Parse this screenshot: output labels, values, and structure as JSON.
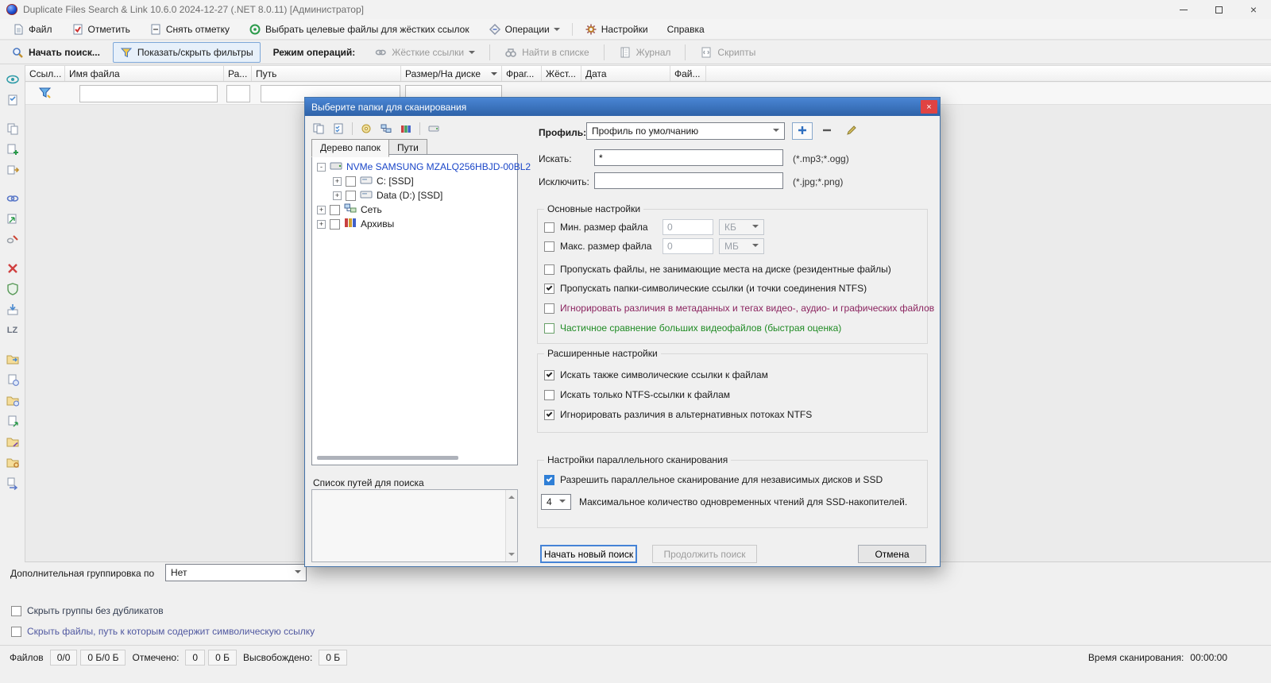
{
  "colors": {
    "accent_blue": "#2f7fd6",
    "dialog_titlebar_from": "#4a86d4",
    "dialog_titlebar_to": "#2e62a8",
    "close_button_red": "#e04343",
    "metadata_text": "#8b2560",
    "partial_compare_text": "#1f8b24",
    "tree_selected_text": "#1a46c8",
    "hide_groups_text": "#323c50",
    "hide_symlink_text": "#5058a0"
  },
  "titlebar": {
    "title": "Duplicate Files Search & Link 10.6.0 2024-12-27 (.NET 8.0.11) [Администратор]"
  },
  "menubar": {
    "file": "Файл",
    "mark": "Отметить",
    "unmark": "Снять отметку",
    "select_targets": "Выбрать целевые файлы для жёстких ссылок",
    "operations": "Операции",
    "settings": "Настройки",
    "help": "Справка"
  },
  "toolbar": {
    "start_search": "Начать поиск...",
    "toggle_filters": "Показать/скрыть фильтры",
    "operations_mode": "Режим операций:",
    "hard_links": "Жёсткие ссылки",
    "find_in_list": "Найти в списке",
    "journal": "Журнал",
    "scripts": "Скрипты"
  },
  "grid": {
    "columns": [
      "Ссыл...",
      "Имя файла",
      "Ра...",
      "Путь",
      "Размер/На диске",
      "Фраг...",
      "Жёст...",
      "Дата",
      "Фай..."
    ],
    "filter_values": {
      "name": "",
      "ra": "",
      "path": "",
      "size": ""
    }
  },
  "sidebar": {
    "lz_label": "LZ"
  },
  "dialog": {
    "title": "Выберите папки для сканирования",
    "tabs": {
      "tree": "Дерево папок",
      "paths": "Пути"
    },
    "tree": [
      {
        "label": "NVMe SAMSUNG MZALQ256HBJD-00BL2",
        "selected": true
      },
      {
        "label": "C: [SSD]",
        "checked": false
      },
      {
        "label": "Data (D:) [SSD]",
        "checked": false
      },
      {
        "label": "Сеть",
        "checked": false
      },
      {
        "label": "Архивы",
        "checked": false
      }
    ],
    "paths_list_label": "Список путей для поиска",
    "profile": {
      "label": "Профиль:",
      "value": "Профиль по умолчанию"
    },
    "search": {
      "label": "Искать:",
      "value": "*",
      "hint": "(*.mp3;*.ogg)"
    },
    "exclude": {
      "label": "Исключить:",
      "value": "",
      "hint": "(*.jpg;*.png)"
    },
    "basic": {
      "title": "Основные настройки",
      "min_size": {
        "label": "Мин. размер файла",
        "value": "0",
        "unit": "КБ",
        "checked": false
      },
      "max_size": {
        "label": "Макс. размер файла",
        "value": "0",
        "unit": "МБ",
        "checked": false
      },
      "skip_resident": {
        "label": "Пропускать файлы, не занимающие места на диске (резидентные файлы)",
        "checked": false
      },
      "skip_symlink_dirs": {
        "label": "Пропускать папки-символические ссылки (и точки соединения NTFS)",
        "checked": true
      },
      "ignore_metadata": {
        "label": "Игнорировать различия в метаданных и тегах видео-, аудио- и графических файлов",
        "checked": false
      },
      "partial_compare": {
        "label": "Частичное сравнение больших видеофайлов (быстрая оценка)",
        "checked": false
      }
    },
    "advanced": {
      "title": "Расширенные настройки",
      "search_symlinks": {
        "label": "Искать также символические ссылки к файлам",
        "checked": true
      },
      "only_ntfs_links": {
        "label": "Искать только NTFS-ссылки к файлам",
        "checked": false
      },
      "ignore_ads": {
        "label": "Игнорировать различия в альтернативных потоках NTFS",
        "checked": true
      }
    },
    "parallel": {
      "title": "Настройки параллельного сканирования",
      "allow_parallel": {
        "label": "Разрешить параллельное сканирование для независимых дисков и SSD",
        "checked": true
      },
      "max_reads": {
        "value": "4",
        "label": "Максимальное количество одновременных чтений для SSD-накопителей."
      }
    },
    "buttons": {
      "new_search": "Начать новый поиск",
      "continue_search": "Продолжить поиск",
      "cancel": "Отмена"
    }
  },
  "bottom": {
    "grouping_label": "Дополнительная группировка по",
    "grouping_value": "Нет",
    "hide_groups_label": "Скрыть группы без дубликатов",
    "hide_symlink_label": "Скрыть файлы, путь к которым содержит символическую ссылку"
  },
  "statusbar": {
    "files_label": "Файлов",
    "files_count": "0/0",
    "files_size": "0 Б/0 Б",
    "marked_label": "Отмечено:",
    "marked_count": "0",
    "marked_size": "0 Б",
    "freed_label": "Высвобождено:",
    "freed_size": "0 Б",
    "scan_time_label": "Время сканирования:",
    "scan_time_value": "00:00:00"
  }
}
